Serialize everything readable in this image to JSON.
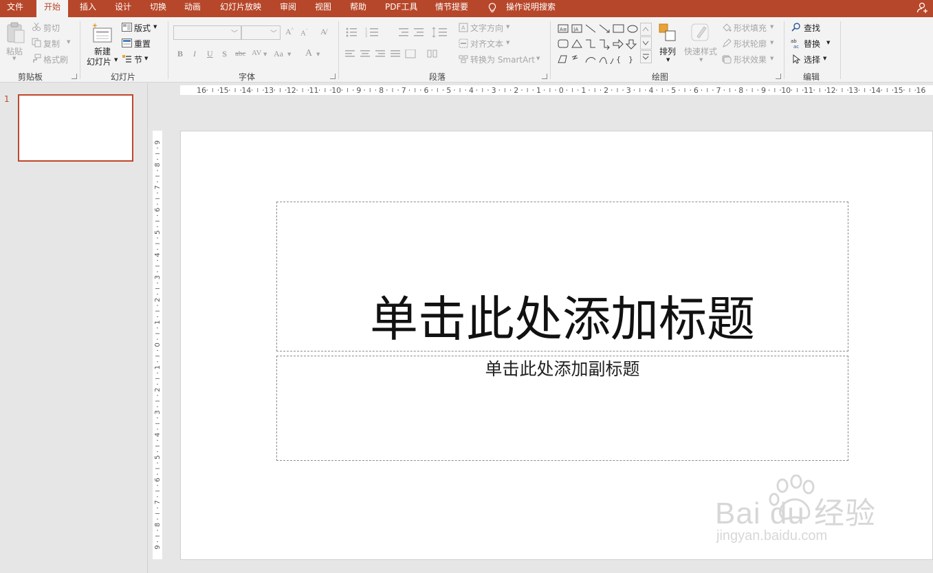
{
  "tabs": {
    "file": "文件",
    "home": "开始",
    "insert": "插入",
    "design": "设计",
    "transitions": "切换",
    "animations": "动画",
    "slideshow": "幻灯片放映",
    "review": "审阅",
    "view": "视图",
    "help": "帮助",
    "pdf": "PDF工具",
    "storyline": "情节提要",
    "tell_me": "操作说明搜索"
  },
  "ribbon": {
    "clipboard": {
      "label": "剪贴板",
      "paste": "粘贴",
      "cut": "剪切",
      "copy": "复制",
      "format_painter": "格式刷"
    },
    "slides": {
      "label": "幻灯片",
      "new_slide_1": "新建",
      "new_slide_2": "幻灯片",
      "layout": "版式",
      "reset": "重置",
      "section": "节"
    },
    "font": {
      "label": "字体",
      "bold": "B",
      "italic": "I",
      "underline": "U",
      "shadow": "S",
      "strike": "abc",
      "spacing": "AV",
      "case": "Aa",
      "color": "A"
    },
    "paragraph": {
      "label": "段落",
      "text_direction": "文字方向",
      "align_text": "对齐文本",
      "smartart": "转换为 SmartArt"
    },
    "drawing": {
      "label": "绘图",
      "arrange": "排列",
      "quick_styles": "快速样式",
      "shape_fill": "形状填充",
      "shape_outline": "形状轮廓",
      "shape_effects": "形状效果"
    },
    "editing": {
      "label": "编辑",
      "find": "查找",
      "replace": "替换",
      "select": "选择"
    }
  },
  "thumbnails": {
    "slide_number": "1"
  },
  "ruler": {
    "horizontal": [
      "16",
      "15",
      "14",
      "13",
      "12",
      "11",
      "10",
      "9",
      "8",
      "7",
      "6",
      "5",
      "4",
      "3",
      "2",
      "1",
      "0",
      "1",
      "2",
      "3",
      "4",
      "5",
      "6",
      "7",
      "8",
      "9",
      "10",
      "11",
      "12",
      "13",
      "14",
      "15",
      "16"
    ],
    "vertical": [
      "9",
      "8",
      "7",
      "6",
      "5",
      "4",
      "3",
      "2",
      "1",
      "0",
      "1",
      "2",
      "3",
      "4",
      "5",
      "6",
      "7",
      "8",
      "9"
    ]
  },
  "slide": {
    "title_placeholder": "单击此处添加标题",
    "subtitle_placeholder": "单击此处添加副标题"
  },
  "watermark": {
    "main": "Bai du 经验",
    "sub": "jingyan.baidu.com"
  },
  "colors": {
    "accent": "#b7472a",
    "ribbon_bg": "#f3f3f3",
    "workspace_bg": "#e6e6e6"
  }
}
